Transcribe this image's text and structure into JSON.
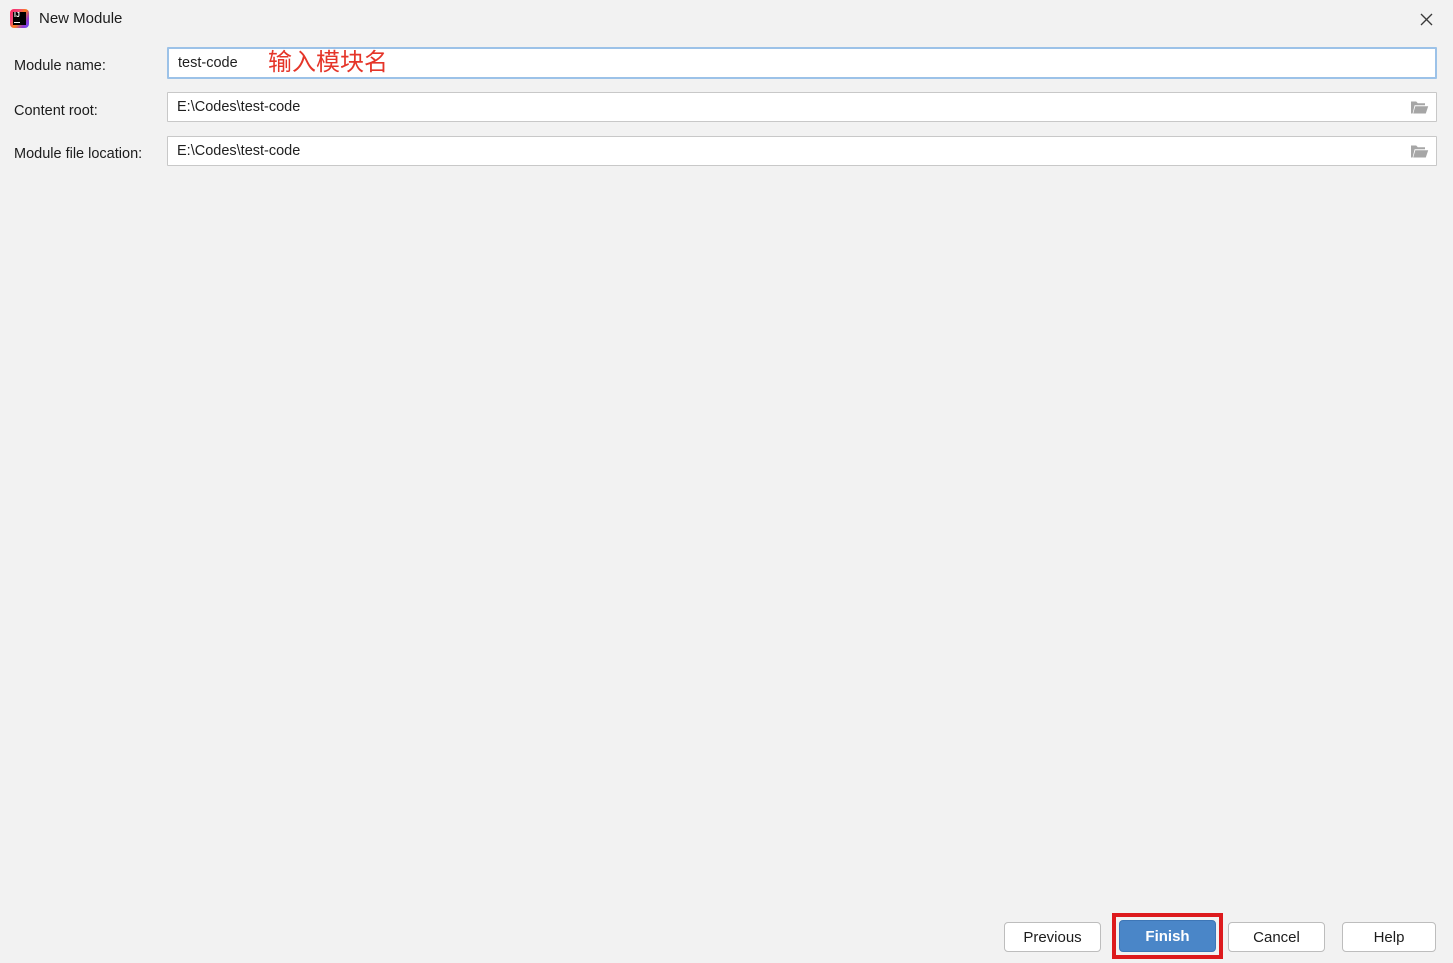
{
  "window": {
    "title": "New Module"
  },
  "form": {
    "module_name": {
      "label": "Module name:",
      "value": "test-code",
      "annotation": "输入模块名"
    },
    "content_root": {
      "label": "Content root:",
      "value": "E:\\Codes\\test-code"
    },
    "module_file_location": {
      "label": "Module file location:",
      "value": "E:\\Codes\\test-code"
    }
  },
  "buttons": {
    "previous": "Previous",
    "finish": "Finish",
    "cancel": "Cancel",
    "help": "Help"
  },
  "icons": {
    "app": "intellij-idea-logo",
    "close": "x-cross",
    "browse": "open-folder"
  },
  "colors": {
    "background": "#F2F2F2",
    "accent_blue": "#4A86C8",
    "accent_blue_border": "#3D76B7",
    "focus_border": "#9CC2E8",
    "annotation_red": "#E53529",
    "highlight_red": "#DD1A1D",
    "input_border": "#C8C8C8",
    "button_border": "#BDBDBD",
    "text": "#1D1D1D",
    "folder_icon_gray": "#A6A6A6"
  }
}
